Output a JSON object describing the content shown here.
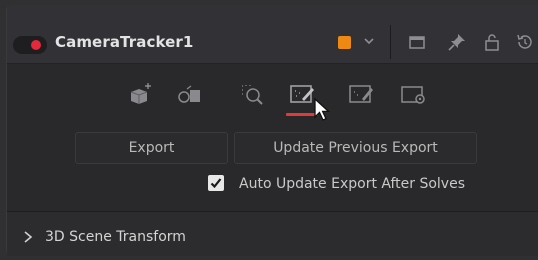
{
  "header": {
    "title": "CameraTracker1",
    "accent_color": "#ee8a12",
    "status_color": "#e5283a",
    "icons": [
      "collapse-dot-icon",
      "color-swatch-icon",
      "chevron-down-icon",
      "window-icon",
      "pin-icon",
      "lock-icon",
      "reset-icon"
    ]
  },
  "toolbar": {
    "tools": [
      "track-icon",
      "solve-icon",
      "refine-icon",
      "export-icon",
      "edit-export-icon",
      "options-icon"
    ],
    "active_tool": "export-icon",
    "active_color": "#e23a3a"
  },
  "actions": {
    "export_label": "Export",
    "update_label": "Update Previous Export"
  },
  "options": {
    "auto_update_label": "Auto Update Export After Solves",
    "auto_update_checked": true
  },
  "section": {
    "label": "3D Scene Transform",
    "expanded": false
  }
}
